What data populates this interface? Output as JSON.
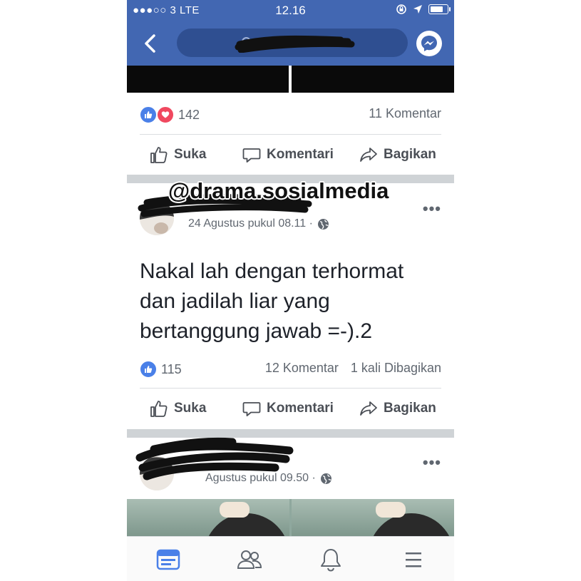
{
  "status_bar": {
    "carrier": "●●●○○ 3  LTE",
    "time": "12.16"
  },
  "top_post": {
    "reaction_count": "142",
    "comments": "11 Komentar",
    "actions": {
      "like": "Suka",
      "comment": "Komentari",
      "share": "Bagikan"
    }
  },
  "watermark": "@drama.sosialmedia",
  "main_post": {
    "timestamp": "24 Agustus pukul 08.11 ·",
    "text_lines": [
      "Nakal lah dengan terhormat",
      "dan jadilah liar yang",
      "bertanggung jawab =-).2"
    ],
    "reaction_count": "115",
    "comments": "12 Komentar",
    "shares": "1 kali Dibagikan",
    "actions": {
      "like": "Suka",
      "comment": "Komentari",
      "share": "Bagikan"
    }
  },
  "next_post": {
    "timestamp": "Agustus pukul 09.50 ·"
  },
  "colors": {
    "brand_blue": "#4267b2",
    "like_blue": "#4a80e8",
    "love_red": "#f0485f"
  },
  "tab_bar": {
    "icons": [
      "news-feed-icon",
      "friends-icon",
      "notifications-icon",
      "menu-icon"
    ]
  }
}
